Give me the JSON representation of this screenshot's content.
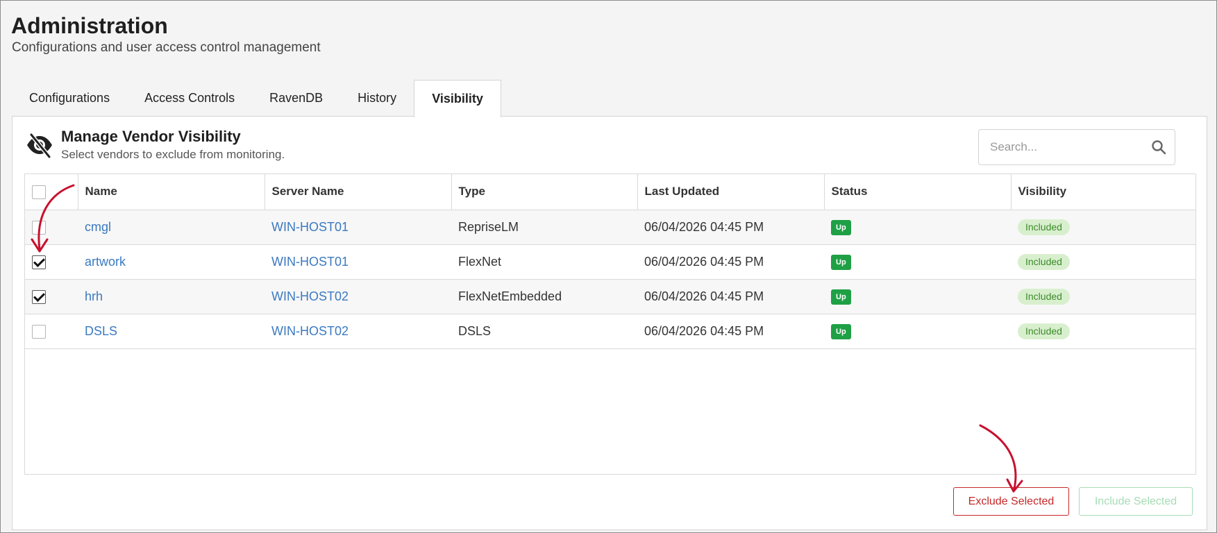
{
  "header": {
    "title": "Administration",
    "subtitle": "Configurations and user access control management"
  },
  "tabs": [
    {
      "label": "Configurations",
      "active": false
    },
    {
      "label": "Access Controls",
      "active": false
    },
    {
      "label": "RavenDB",
      "active": false
    },
    {
      "label": "History",
      "active": false
    },
    {
      "label": "Visibility",
      "active": true
    }
  ],
  "panel": {
    "icon": "eye-slash-icon",
    "title": "Manage Vendor Visibility",
    "subtitle": "Select vendors to exclude from monitoring.",
    "search": {
      "placeholder": "Search...",
      "value": ""
    }
  },
  "table": {
    "columns": [
      "Name",
      "Server Name",
      "Type",
      "Last Updated",
      "Status",
      "Visibility"
    ],
    "rows": [
      {
        "checked": false,
        "name": "cmgl",
        "server": "WIN-HOST01",
        "type": "RepriseLM",
        "updated": "06/04/2026 04:45 PM",
        "status": "Up",
        "visibility": "Included"
      },
      {
        "checked": true,
        "name": "artwork",
        "server": "WIN-HOST01",
        "type": "FlexNet",
        "updated": "06/04/2026 04:45 PM",
        "status": "Up",
        "visibility": "Included"
      },
      {
        "checked": true,
        "name": "hrh",
        "server": "WIN-HOST02",
        "type": "FlexNetEmbedded",
        "updated": "06/04/2026 04:45 PM",
        "status": "Up",
        "visibility": "Included"
      },
      {
        "checked": false,
        "name": "DSLS",
        "server": "WIN-HOST02",
        "type": "DSLS",
        "updated": "06/04/2026 04:45 PM",
        "status": "Up",
        "visibility": "Included"
      }
    ]
  },
  "actions": {
    "exclude_label": "Exclude Selected",
    "include_label": "Include Selected"
  },
  "colors": {
    "status_up": "#1fa045",
    "visibility_included_bg": "#d8efce",
    "exclude": "#c62828",
    "include_disabled": "#a6dcb5",
    "link": "#3a79c0",
    "annotation_arrow": "#c8102e"
  }
}
